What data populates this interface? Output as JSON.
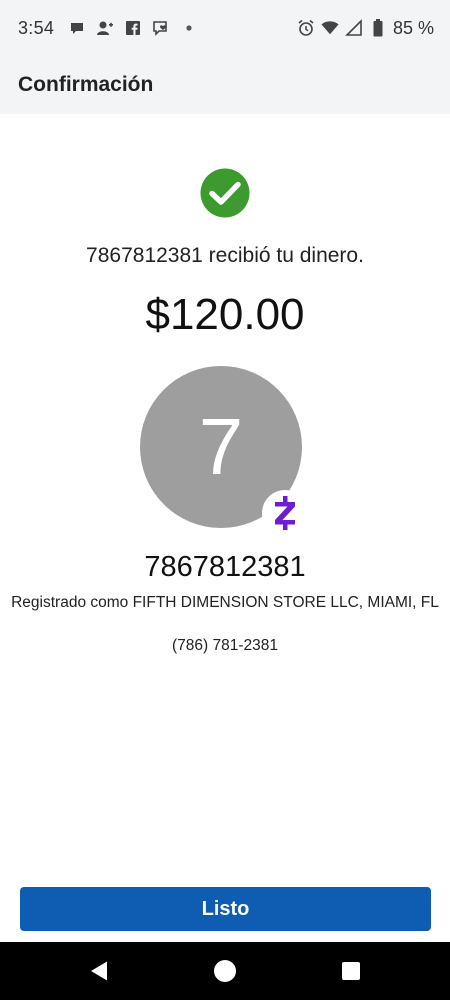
{
  "status_bar": {
    "time": "3:54",
    "left_icons": [
      "chat-bubble-icon",
      "person-add-icon",
      "facebook-icon",
      "chat-heart-icon",
      "dot-icon"
    ],
    "right_icons": [
      "alarm-icon",
      "wifi-icon",
      "signal-icon",
      "battery-icon"
    ],
    "battery": "85 %"
  },
  "header": {
    "title": "Confirmación"
  },
  "confirmation": {
    "success_icon": "check-circle-icon",
    "success_color": "#3d9a2f",
    "message": "7867812381 recibió tu dinero.",
    "amount": "$120.00"
  },
  "recipient": {
    "avatar_letter": "7",
    "avatar_color": "#9e9e9e",
    "badge_icon": "zelle-icon",
    "badge_color": "#6d1ed4",
    "name": "7867812381",
    "registered": "Registrado como FIFTH DIMENSION STORE LLC, MIAMI, FL",
    "phone": "(786) 781-2381"
  },
  "actions": {
    "done_label": "Listo",
    "button_color": "#0f5db3"
  },
  "nav": {
    "icons": [
      "back-icon",
      "home-icon",
      "recents-icon"
    ]
  }
}
